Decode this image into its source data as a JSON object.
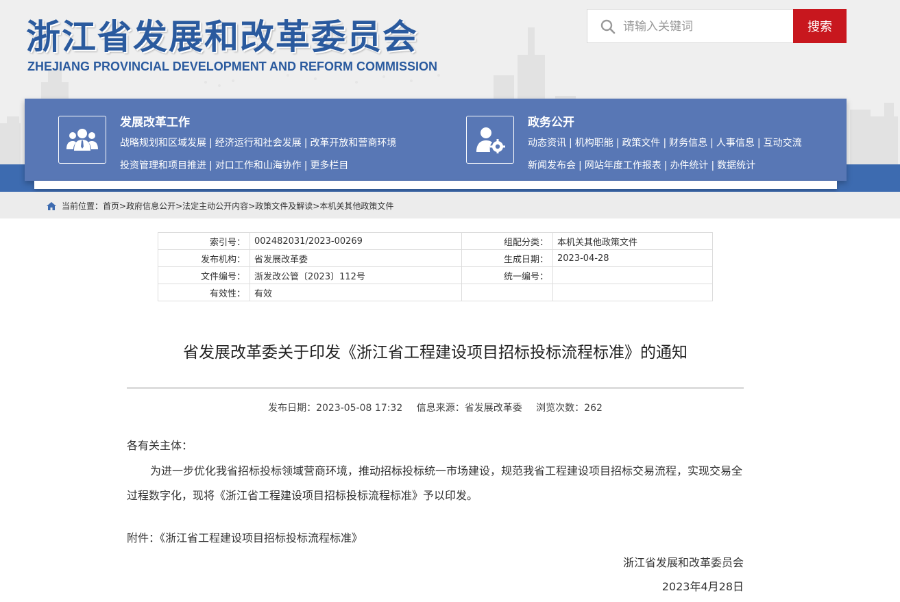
{
  "header": {
    "title_cn": "浙江省发展和改革委员会",
    "title_en": "ZHEJIANG PROVINCIAL DEVELOPMENT AND REFORM COMMISSION",
    "colors": {
      "brand_blue": "#2a5a9e",
      "nav_blue": "#5877b5",
      "search_red": "#c8171e"
    }
  },
  "search": {
    "placeholder": "请输入关键词",
    "button_label": "搜索",
    "icon": "search-icon"
  },
  "nav": {
    "left": {
      "title": "发展改革工作",
      "icon": "people-group-icon",
      "row1": [
        "战略规划和区域发展",
        "经济运行和社会发展",
        "改革开放和营商环境"
      ],
      "row2": [
        "投资管理和项目推进",
        "对口工作和山海协作",
        "更多栏目"
      ]
    },
    "right": {
      "title": "政务公开",
      "icon": "user-gear-icon",
      "row1": [
        "动态资讯",
        "机构职能",
        "政策文件",
        "财务信息",
        "人事信息",
        "互动交流"
      ],
      "row2": [
        "新闻发布会",
        "网站年度工作报表",
        "办件统计",
        "数据统计"
      ]
    }
  },
  "breadcrumb": {
    "prefix": "当前位置：",
    "items": [
      "首页",
      "政府信息公开",
      "法定主动公开内容",
      "政策文件及解读",
      "本机关其他政策文件"
    ],
    "separator": ">"
  },
  "info_table": {
    "rows": [
      {
        "k1": "索引号：",
        "v1": "002482031/2023-00269",
        "k2": "组配分类：",
        "v2": "本机关其他政策文件"
      },
      {
        "k1": "发布机构：",
        "v1": "省发展改革委",
        "k2": "生成日期：",
        "v2": "2023-04-28"
      },
      {
        "k1": "文件编号：",
        "v1": "浙发改公管〔2023〕112号",
        "k2": "统一编号：",
        "v2": ""
      },
      {
        "k1": "有效性：",
        "v1": "有效",
        "k2": "",
        "v2": ""
      }
    ]
  },
  "article": {
    "title": "省发展改革委关于印发《浙江省工程建设项目招标投标流程标准》的通知",
    "publish_date": "发布日期：2023-05-08 17:32",
    "source": "信息来源：省发展改革委",
    "views": "浏览次数：262",
    "greeting": "各有关主体：",
    "paragraph": "为进一步优化我省招标投标领域营商环境，推动招标投标统一市场建设，规范我省工程建设项目招标交易流程，实现交易全过程数字化，现将《浙江省工程建设项目招标投标流程标准》予以印发。",
    "attachment": "附件：《浙江省工程建设项目招标投标流程标准》",
    "signature": "浙江省发展和改革委员会",
    "date": "2023年4月28日"
  }
}
